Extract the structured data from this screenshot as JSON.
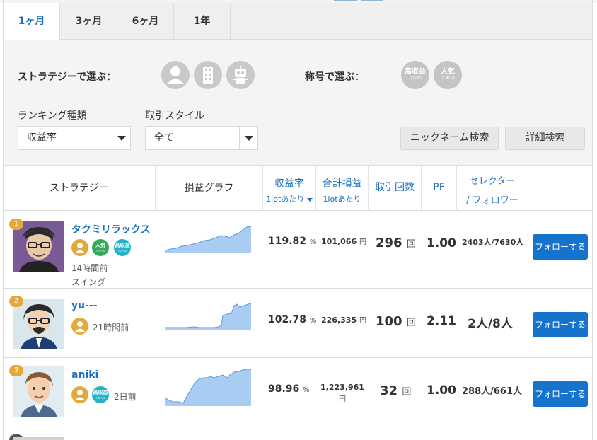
{
  "tabs": [
    "1ヶ月",
    "3ヶ月",
    "6ヶ月",
    "1年"
  ],
  "filters": {
    "strategy_label": "ストラテジーで選ぶ：",
    "title_label": "称号で選ぶ：",
    "title_badges": [
      {
        "main": "高収益",
        "sub": "TOP10"
      },
      {
        "main": "人気",
        "sub": "TOP10"
      }
    ],
    "ranking_label": "ランキング種類",
    "ranking_value": "収益率",
    "style_label": "取引スタイル",
    "style_value": "全て",
    "nickname_button": "ニックネーム検索",
    "detail_button": "詳細検索"
  },
  "table": {
    "h_strategy": "ストラテジー",
    "h_graph": "損益グラフ",
    "h_return": "収益率",
    "h_return_sub": "1lotあたり",
    "h_total": "合計損益",
    "h_total_sub": "1lotあたり",
    "h_trades": "取引回数",
    "h_pf": "PF",
    "h_selector": "セレクター",
    "h_follower": "/ フォロワー"
  },
  "rows": [
    {
      "rank": "1",
      "name": "タクミリラックス",
      "badges": [
        {
          "main": "人気",
          "sub": "TOP10"
        },
        {
          "main": "高収益",
          "sub": "TOP10"
        }
      ],
      "time": "14時間前",
      "style": "スイング",
      "return_value": "119.82",
      "return_unit": "%",
      "total_line1": "101,066",
      "total_line2": "",
      "total_unit": "円",
      "trades": "296",
      "trades_unit": "回",
      "pf": "1.00",
      "selectors": "2403人/7630人",
      "follow": "フォローする"
    },
    {
      "rank": "2",
      "name": "yu---",
      "badges": [],
      "time": "21時間前",
      "style": "",
      "return_value": "102.78",
      "return_unit": "%",
      "total_line1": "226,335",
      "total_line2": "",
      "total_unit": "円",
      "trades": "100",
      "trades_unit": "回",
      "pf": "2.11",
      "selectors": "2人/8人",
      "follow": "フォローする"
    },
    {
      "rank": "3",
      "name": "aniki",
      "badges": [
        {
          "main": "高収益",
          "sub": "TOP10"
        }
      ],
      "time": "2日前",
      "style": "",
      "return_value": "98.96",
      "return_unit": "%",
      "total_line1": "1,223,961",
      "total_line2": "円",
      "total_unit": "",
      "trades": "32",
      "trades_unit": "回",
      "pf": "1.00",
      "selectors": "288人/661人",
      "follow": "フォローする"
    }
  ],
  "colors": {
    "accent": "#1a6fc4",
    "follow_button": "#1673cc",
    "rank_badge": "#e4a93a",
    "badge_green": "#35a95a",
    "badge_teal": "#22b3c6",
    "graph_fill": "#a9ccf2",
    "graph_line": "#5b9be0"
  }
}
